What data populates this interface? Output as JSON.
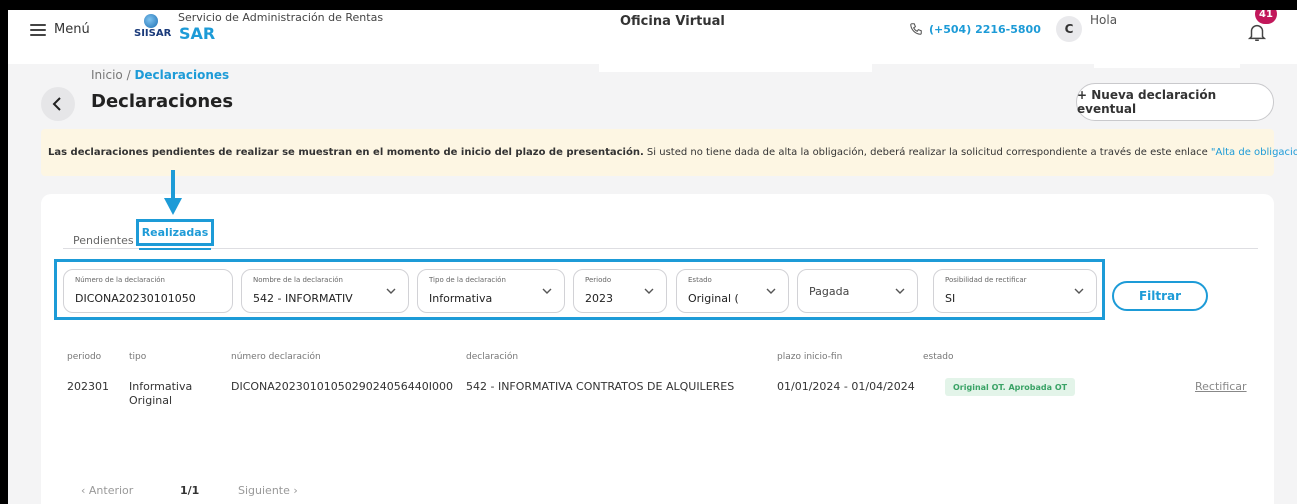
{
  "header": {
    "menu_label": "Menú",
    "logo_text": "SIISAR",
    "org_name": "Servicio de Administración de Rentas",
    "org_short": "SAR",
    "office": "Oficina Virtual",
    "phone": "(+504) 2216-5800",
    "avatar_initial": "C",
    "greeting": "Hola",
    "notifications": "41"
  },
  "breadcrumb": {
    "root": "Inicio",
    "separator": " / ",
    "current": "Declaraciones"
  },
  "page": {
    "title": "Declaraciones",
    "new_button": "+ Nueva declaración eventual"
  },
  "notice": {
    "bold": "Las declaraciones pendientes de realizar se muestran en el momento de inicio del plazo de presentación.",
    "text": " Si usted no tiene dada de alta la obligación, deberá realizar la solicitud correspondiente a través de este enlace ",
    "link": "\"Alta de obligaciones\".",
    "arrow_color": "#1d9bd7"
  },
  "tabs": [
    {
      "label": "Pendientes",
      "active": false
    },
    {
      "label": "Realizadas",
      "active": true
    }
  ],
  "filters": {
    "numero": {
      "label": "Número de la declaración",
      "value": "DICONA20230101050"
    },
    "nombre": {
      "label": "Nombre de la declaración",
      "value": "542 - INFORMATIV"
    },
    "tipo": {
      "label": "Tipo de la declaración",
      "value": "Informativa"
    },
    "periodo": {
      "label": "Periodo",
      "value": "2023"
    },
    "estado": {
      "label": "Estado",
      "value": "Original ("
    },
    "pagada": {
      "placeholder": "Pagada"
    },
    "rectificar": {
      "label": "Posibilidad de rectificar",
      "value": "SI"
    },
    "button": "Filtrar"
  },
  "table": {
    "headers": [
      "periodo",
      "tipo",
      "número declaración",
      "declaración",
      "plazo inicio-fin",
      "estado"
    ],
    "rows": [
      {
        "periodo": "202301",
        "tipo_1": "Informativa",
        "tipo_2": "Original",
        "numero": "DICONA2023010105029024056440I000",
        "declaracion": "542 - INFORMATIVA CONTRATOS DE ALQUILERES",
        "plazo": "01/01/2024 - 01/04/2024",
        "estado": "Original OT. Aprobada OT",
        "action": "Rectificar"
      }
    ]
  },
  "pager": {
    "prev": "Anterior",
    "page": "1/1",
    "next": "Siguiente"
  },
  "colors": {
    "accent": "#1d9bd7",
    "badge": "#c2185b",
    "notice_bg": "#fdf6e3",
    "status_bg": "#e3f4e9"
  }
}
